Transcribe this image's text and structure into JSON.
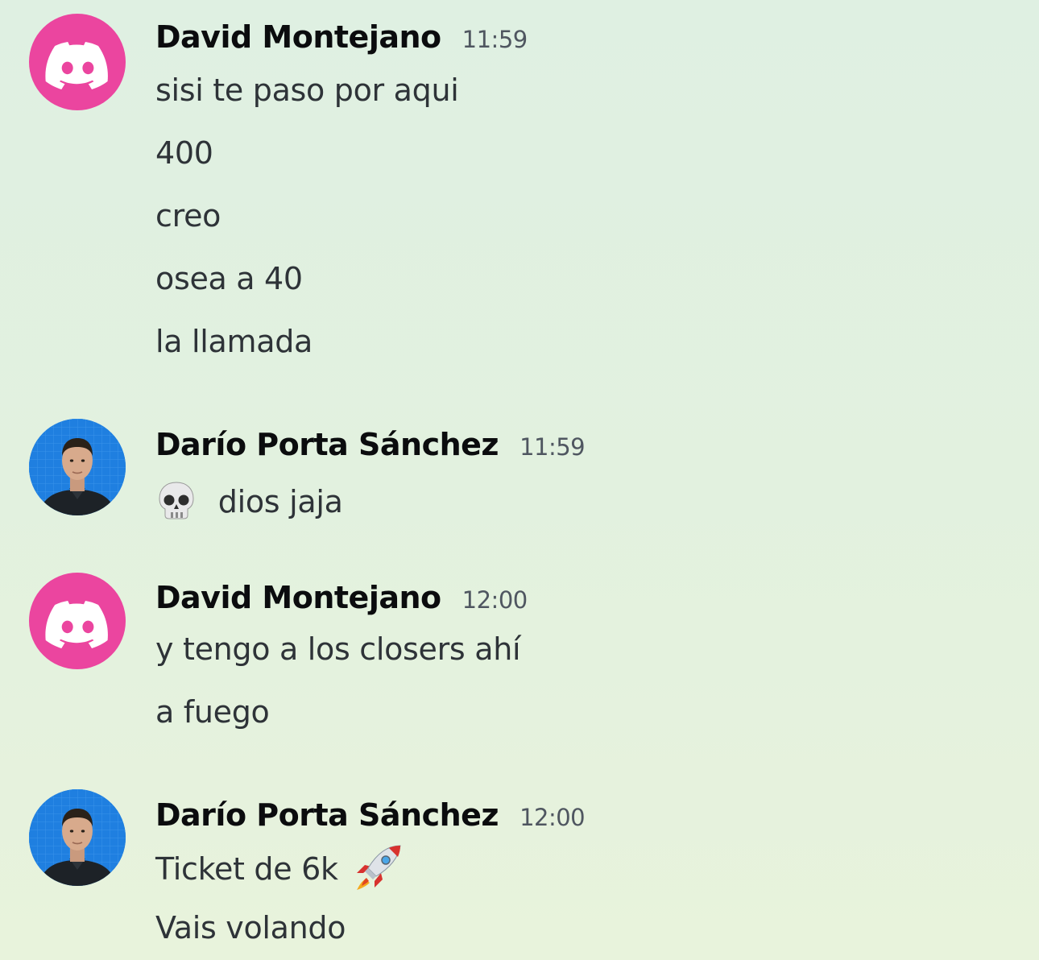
{
  "messages": [
    {
      "author": "David Montejano",
      "time": "11:59",
      "avatar": "discord-logo-icon",
      "avatar_color": "#eb459f",
      "lines": [
        "sisi te paso por aqui",
        "400",
        "creo",
        "osea a 40",
        "la llamada"
      ]
    },
    {
      "author": "Darío Porta Sánchez",
      "time": "11:59",
      "avatar": "user-photo",
      "lines": [
        "dios jaja"
      ],
      "emoji": "skull-emoji"
    },
    {
      "author": "David Montejano",
      "time": "12:00",
      "avatar": "discord-logo-icon",
      "avatar_color": "#eb459f",
      "lines": [
        "y tengo a los closers ahí",
        "a fuego"
      ]
    },
    {
      "author": "Darío Porta Sánchez",
      "time": "12:00",
      "avatar": "user-photo",
      "lines": [
        "Ticket de 6k",
        "Vais volando"
      ],
      "emoji": "rocket-emoji"
    }
  ]
}
